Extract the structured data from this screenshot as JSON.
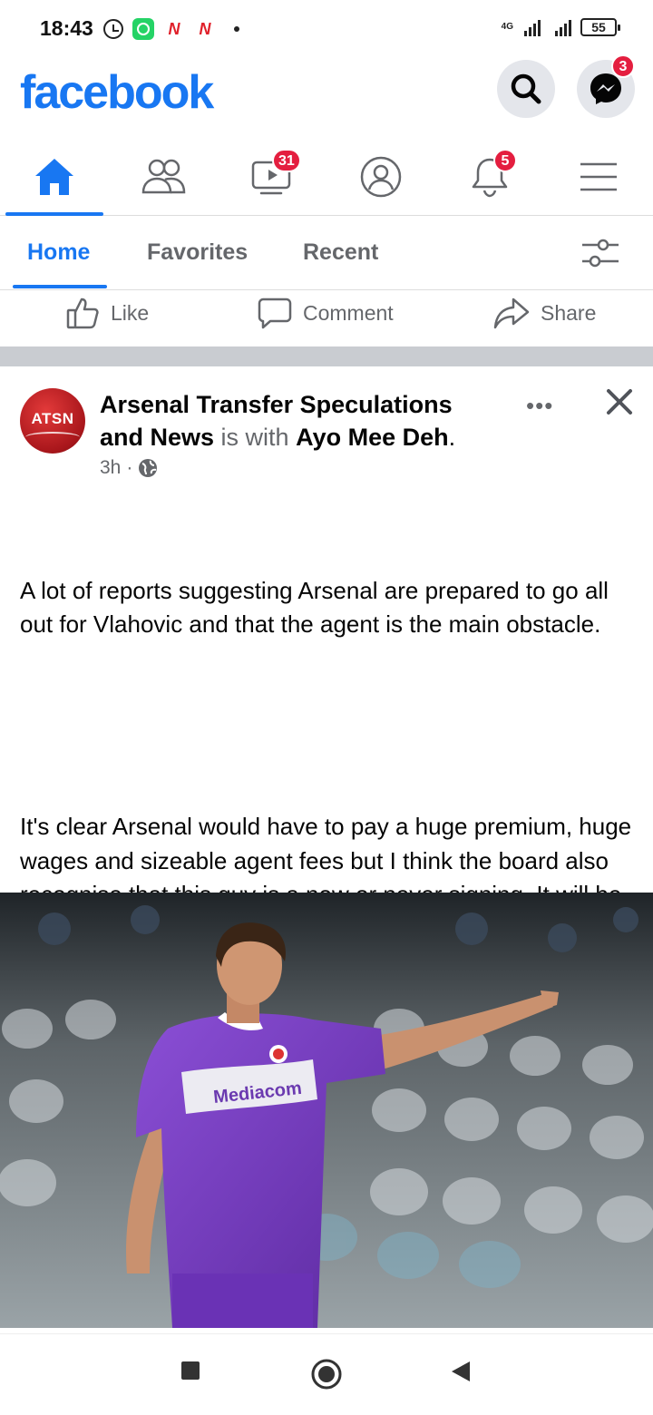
{
  "status_bar": {
    "time": "18:43",
    "notif_n1": "N",
    "notif_n2": "N",
    "network": "4G",
    "battery": "55"
  },
  "header": {
    "logo": "facebook",
    "messenger_badge": "3"
  },
  "nav": {
    "items": [
      {
        "name": "home",
        "icon": "home-icon"
      },
      {
        "name": "friends",
        "icon": "friends-icon"
      },
      {
        "name": "watch",
        "icon": "video-icon",
        "badge": "31"
      },
      {
        "name": "profile",
        "icon": "profile-icon"
      },
      {
        "name": "notifications",
        "icon": "bell-icon",
        "badge": "5"
      },
      {
        "name": "menu",
        "icon": "menu-icon"
      }
    ]
  },
  "feed_tabs": {
    "home": "Home",
    "favorites": "Favorites",
    "recent": "Recent"
  },
  "actions": {
    "like": "Like",
    "comment": "Comment",
    "share": "Share"
  },
  "post": {
    "avatar_text": "ATSN",
    "page_name": "Arsenal Transfer Speculations and News",
    "with_text": " is with ",
    "tagged": "Ayo Mee Deh",
    "period": ".",
    "time": "3h",
    "sep": "·",
    "more": "•••",
    "body_p1": "A lot of reports suggesting Arsenal are prepared to go all out for Vlahovic and that the agent is the main obstacle.",
    "body_p2": "It's clear Arsenal would have to pay a huge premium, huge wages and sizeable agent fees but I think the board also recognise that this guy is a now or never signing. It will be a lot harder to sign him in the summer when most of the clubs who do not sign Haaland will surely be sniffing around this guy as a back up",
    "photo_sponsor": "Mediacom"
  },
  "colors": {
    "brand": "#1877f2",
    "badge": "#e41e3f",
    "muted": "#65676b",
    "jersey": "#7b3fc4"
  }
}
